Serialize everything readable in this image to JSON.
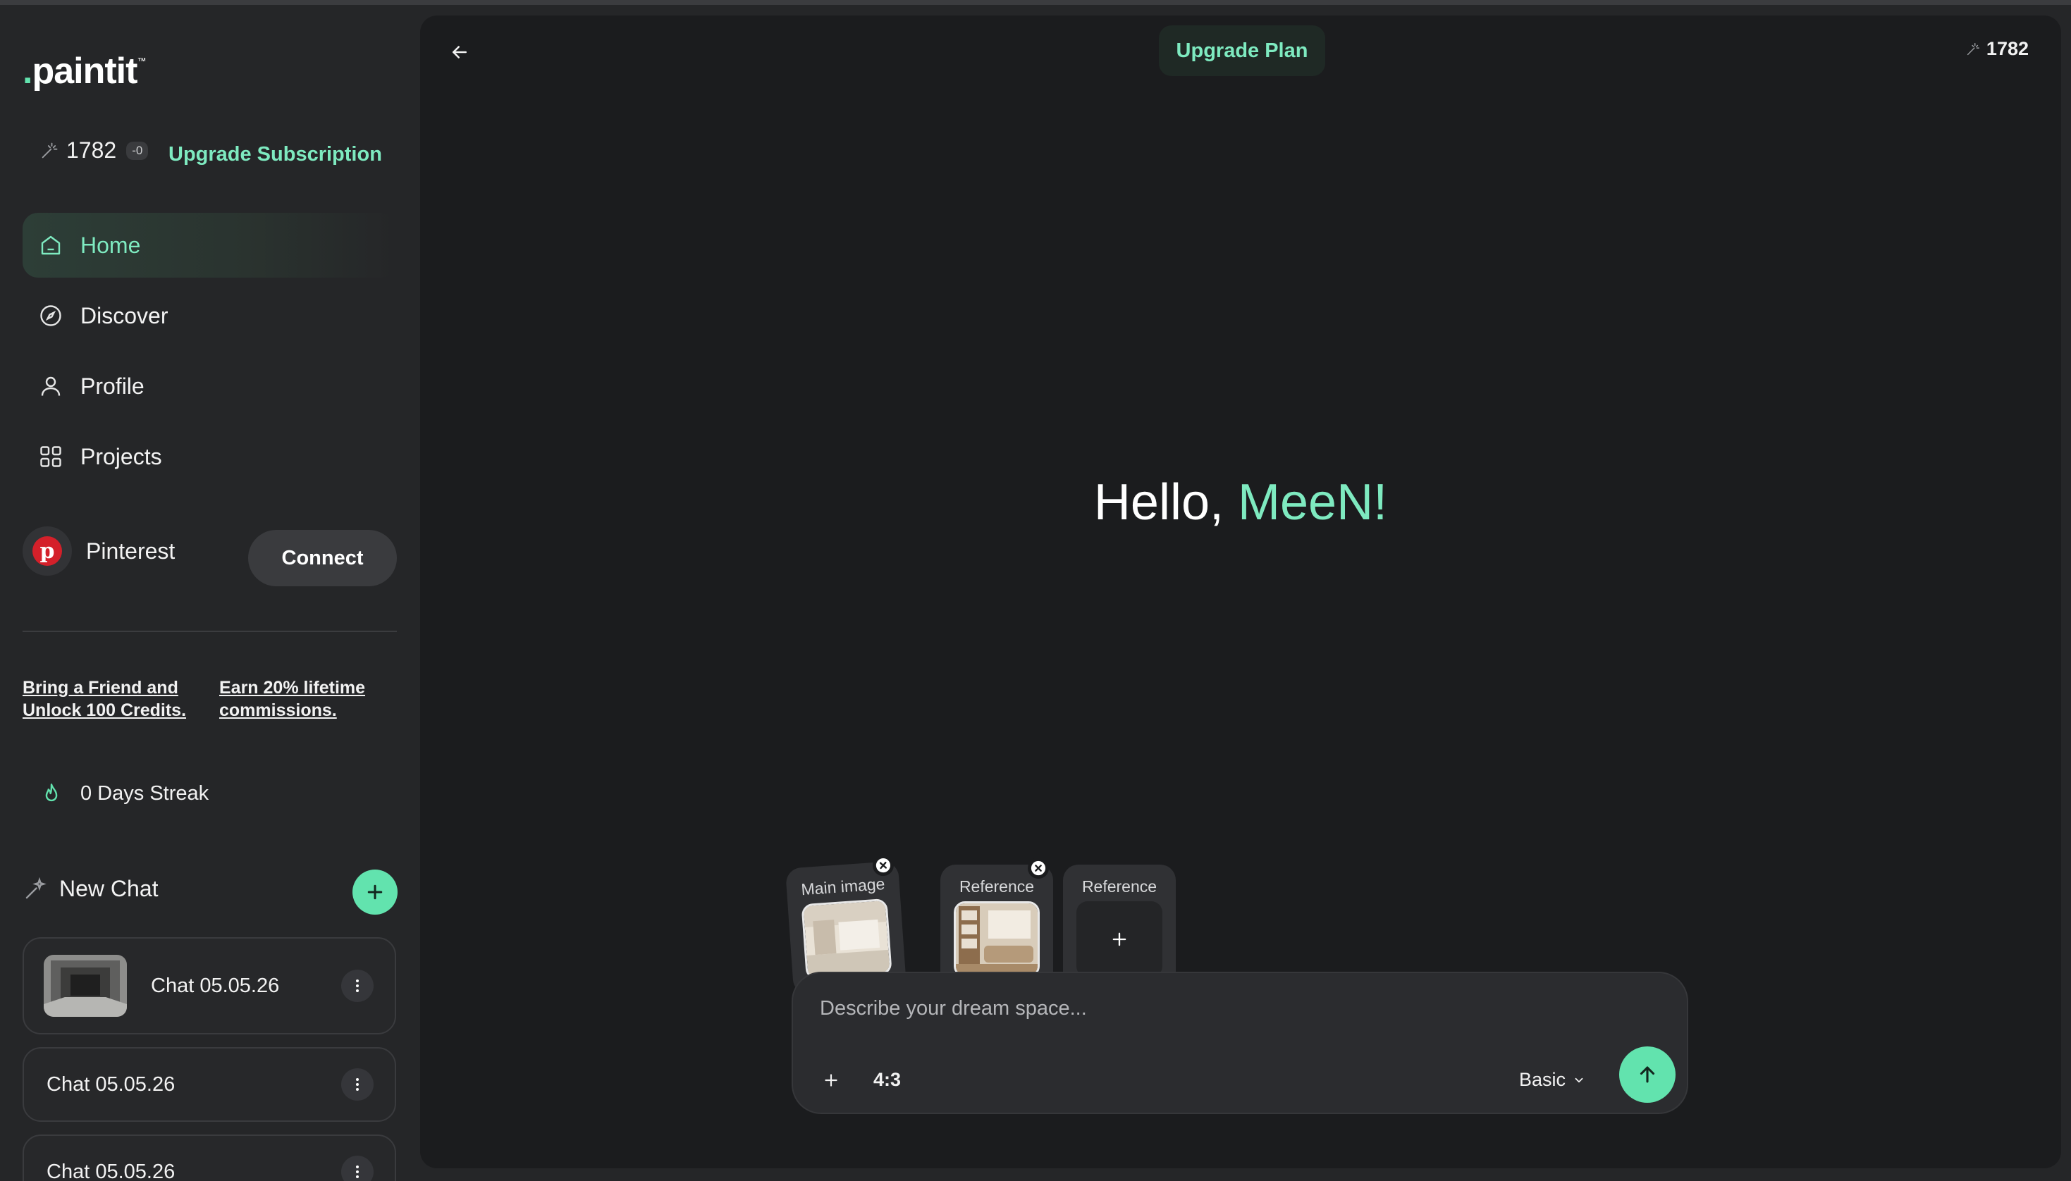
{
  "app": {
    "logo_text": "paintit",
    "logo_tm": "™",
    "credits": "1782",
    "credits_delta": "-0",
    "upgrade_subscription": "Upgrade Subscription"
  },
  "sidebar": {
    "nav": [
      {
        "label": "Home",
        "icon": "home-icon",
        "active": true
      },
      {
        "label": "Discover",
        "icon": "compass-icon",
        "active": false
      },
      {
        "label": "Profile",
        "icon": "user-icon",
        "active": false
      },
      {
        "label": "Projects",
        "icon": "grid-icon",
        "active": false
      }
    ],
    "pinterest": {
      "label": "Pinterest",
      "connect": "Connect"
    },
    "referral": {
      "friend_line1": "Bring a Friend and",
      "friend_line2": "Unlock 100 Credits.",
      "earn_line1": "Earn 20% lifetime",
      "earn_line2": "commissions."
    },
    "streak": "0 Days Streak",
    "new_chat": "New Chat",
    "chats": [
      {
        "label": "Chat 05.05.26",
        "has_thumb": true
      },
      {
        "label": "Chat 05.05.26",
        "has_thumb": false
      },
      {
        "label": "Chat 05.05.26",
        "has_thumb": false
      }
    ]
  },
  "main": {
    "upgrade_plan": "Upgrade Plan",
    "credits": "1782",
    "greeting_prefix": "Hello, ",
    "greeting_name": "MeeN!",
    "attachments": [
      {
        "caption": "Main image",
        "removable": true
      },
      {
        "caption": "Reference",
        "removable": true
      },
      {
        "caption": "Reference",
        "removable": false
      }
    ],
    "composer": {
      "placeholder": "Describe your dream space...",
      "ratio": "4:3",
      "quality": "Basic"
    }
  },
  "colors": {
    "accent": "#62e3ae",
    "accent_text": "#7eeac0",
    "background": "#252628",
    "panel": "#1b1c1e"
  }
}
